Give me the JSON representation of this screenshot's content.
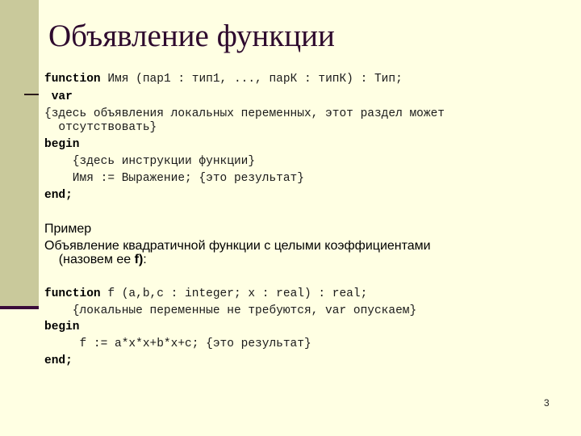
{
  "title": "Объявление функции",
  "syntax": {
    "line1_kw": "function",
    "line1_rest": " Имя (пар1 : тип1, ..., парК : типК) : Тип;",
    "line2_kw": " var",
    "line3": "{здесь объявления локальных переменных, этот раздел может",
    "line4": "  отсутствовать}",
    "line5_kw": "begin",
    "line6": "    {здесь инструкции функции}",
    "line7": "    Имя := Выражение; {это результат}",
    "line8_kw": "end;"
  },
  "example": {
    "heading": "Пример",
    "desc_line1": "Объявление квадратичной функции с целыми коэффициентами",
    "desc_line2_pre": "    (назовем ее ",
    "desc_line2_bold": "f)",
    "desc_line2_post": ":",
    "code_line1_kw": "function",
    "code_line1_rest": " f (a,b,c : integer; x : real) : real;",
    "code_line2": "    {локальные переменные не требуются, var опускаем}",
    "code_line3_kw": "begin",
    "code_line4": "     f := a*x*x+b*x+c; {это результат}",
    "code_line5_kw": "end;"
  },
  "page_number": "3"
}
